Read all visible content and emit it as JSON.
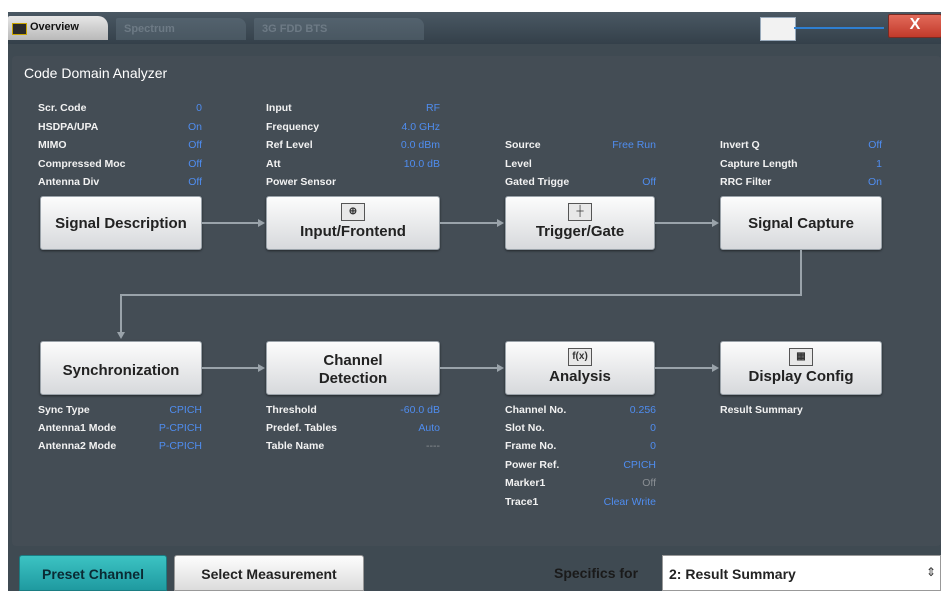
{
  "window": {
    "tabs": [
      {
        "label": "Overview"
      },
      {
        "label": "Spectrum"
      },
      {
        "label": "3G FDD BTS"
      }
    ],
    "close_label": "X"
  },
  "panel": {
    "title": "Code Domain Analyzer"
  },
  "signal_description": {
    "rows": [
      {
        "label": "Scr. Code",
        "value": "0"
      },
      {
        "label": "HSDPA/UPA",
        "value": "On"
      },
      {
        "label": "MIMO",
        "value": "Off"
      },
      {
        "label": "Compressed Moc",
        "value": "Off"
      },
      {
        "label": "Antenna Div",
        "value": "Off"
      }
    ],
    "button": "Signal Description"
  },
  "input_frontend": {
    "rows": [
      {
        "label": "Input",
        "value": "RF"
      },
      {
        "label": "Frequency",
        "value": "4.0 GHz"
      },
      {
        "label": "Ref Level",
        "value": "0.0 dBm"
      },
      {
        "label": "Att",
        "value": "10.0 dB"
      },
      {
        "label": "Power Sensor",
        "value": ""
      }
    ],
    "button": "Input/Frontend",
    "icon": "input-icon"
  },
  "trigger_gate": {
    "rows": [
      {
        "label": "Source",
        "value": "Free Run"
      },
      {
        "label": "Level",
        "value": ""
      },
      {
        "label": "Gated Trigge",
        "value": "Off"
      }
    ],
    "button": "Trigger/Gate",
    "icon": "trigger-icon"
  },
  "signal_capture": {
    "rows": [
      {
        "label": "Invert Q",
        "value": "Off"
      },
      {
        "label": "Capture Length",
        "value": "1"
      },
      {
        "label": "RRC Filter",
        "value": "On"
      }
    ],
    "button": "Signal Capture"
  },
  "synchronization": {
    "button": "Synchronization",
    "rows": [
      {
        "label": "Sync Type",
        "value": "CPICH"
      },
      {
        "label": "Antenna1 Mode",
        "value": "P-CPICH"
      },
      {
        "label": "Antenna2 Mode",
        "value": "P-CPICH"
      }
    ]
  },
  "channel_detection": {
    "button_line1": "Channel",
    "button_line2": "Detection",
    "rows": [
      {
        "label": "Threshold",
        "value": "-60.0 dB"
      },
      {
        "label": "Predef. Tables",
        "value": "Auto"
      },
      {
        "label": "Table Name",
        "value": "----"
      }
    ]
  },
  "analysis": {
    "button": "Analysis",
    "icon": "analysis-icon",
    "rows": [
      {
        "label": "Channel No.",
        "value": "0.256"
      },
      {
        "label": "Slot No.",
        "value": "0"
      },
      {
        "label": "Frame No.",
        "value": "0"
      },
      {
        "label": "Power Ref.",
        "value": "CPICH"
      },
      {
        "label": "Marker1",
        "value": "Off"
      },
      {
        "label": "Trace1",
        "value": "Clear Write"
      }
    ]
  },
  "display_config": {
    "button": "Display Config",
    "icon": "display-icon",
    "rows": [
      {
        "label": "Result Summary",
        "value": ""
      }
    ]
  },
  "footer": {
    "preset_channel": "Preset Channel",
    "select_measurement": "Select Measurement",
    "specifics_label": "Specifics for",
    "specifics_value": "2: Result Summary"
  },
  "colors": {
    "background": "#3f4a52",
    "value_text": "#4f8df0",
    "accent_teal": "#2bb0b3",
    "close_red": "#d24c3c"
  }
}
